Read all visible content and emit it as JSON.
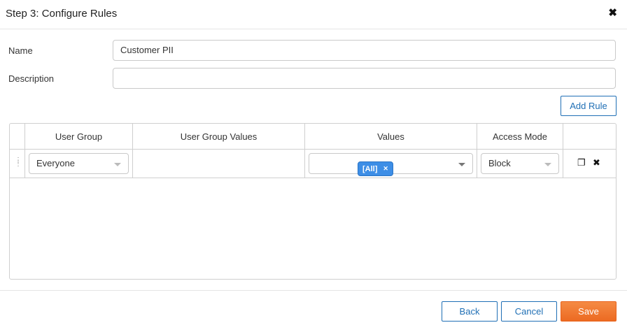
{
  "dialog": {
    "title": "Step 3: Configure Rules",
    "close_icon": "close-icon"
  },
  "form": {
    "name_label": "Name",
    "name_value": "Customer PII",
    "description_label": "Description",
    "description_value": "",
    "add_rule_label": "Add Rule"
  },
  "table": {
    "columns": [
      "User Group",
      "User Group Values",
      "Values",
      "Access Mode"
    ],
    "rows": [
      {
        "user_group": "Everyone",
        "user_group_values": "",
        "values_tag": "[All]",
        "access_mode": "Block"
      }
    ]
  },
  "footer": {
    "back_label": "Back",
    "cancel_label": "Cancel",
    "save_label": "Save"
  },
  "colors": {
    "primary_blue": "#1f6fb5",
    "tag_blue": "#3d8ee6",
    "save_orange": "#ec6a22"
  }
}
